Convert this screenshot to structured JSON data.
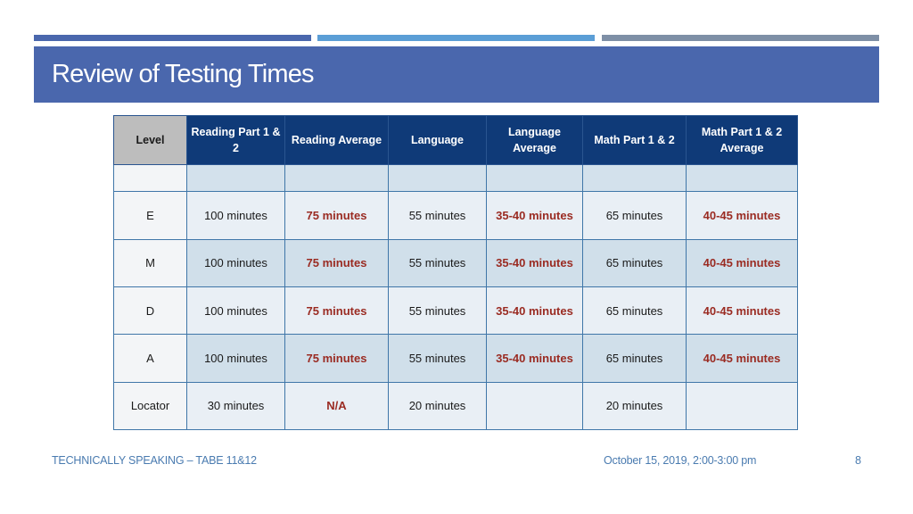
{
  "slide": {
    "title": "Review of Testing Times",
    "accent_colors": {
      "bar1": "#4a67ad",
      "bar2": "#5b9ed6",
      "bar3": "#7e8fa6",
      "header": "#0f3a78",
      "average_text": "#9a2b22"
    }
  },
  "table": {
    "headers": [
      "Level",
      "Reading Part 1 & 2",
      "Reading Average",
      "Language",
      "Language Average",
      "Math Part 1 & 2",
      "Math Part 1 & 2 Average"
    ],
    "rows": [
      {
        "level": "",
        "cells": [
          "",
          "",
          "",
          "",
          "",
          ""
        ]
      },
      {
        "level": "E",
        "cells": [
          "100 minutes",
          "75 minutes",
          "55 minutes",
          "35-40 minutes",
          "65 minutes",
          "40-45 minutes"
        ]
      },
      {
        "level": "M",
        "cells": [
          "100 minutes",
          "75 minutes",
          "55 minutes",
          "35-40 minutes",
          "65 minutes",
          "40-45 minutes"
        ]
      },
      {
        "level": "D",
        "cells": [
          "100 minutes",
          "75 minutes",
          "55 minutes",
          "35-40 minutes",
          "65 minutes",
          "40-45 minutes"
        ]
      },
      {
        "level": "A",
        "cells": [
          "100 minutes",
          "75 minutes",
          "55 minutes",
          "35-40 minutes",
          "65 minutes",
          "40-45 minutes"
        ]
      },
      {
        "level": "Locator",
        "cells": [
          "30 minutes",
          "N/A",
          "20 minutes",
          "",
          "20 minutes",
          ""
        ]
      }
    ]
  },
  "footer": {
    "left": "TECHNICALLY SPEAKING – TABE 11&12",
    "date": "October 15, 2019, 2:00-3:00 pm",
    "page": "8"
  }
}
